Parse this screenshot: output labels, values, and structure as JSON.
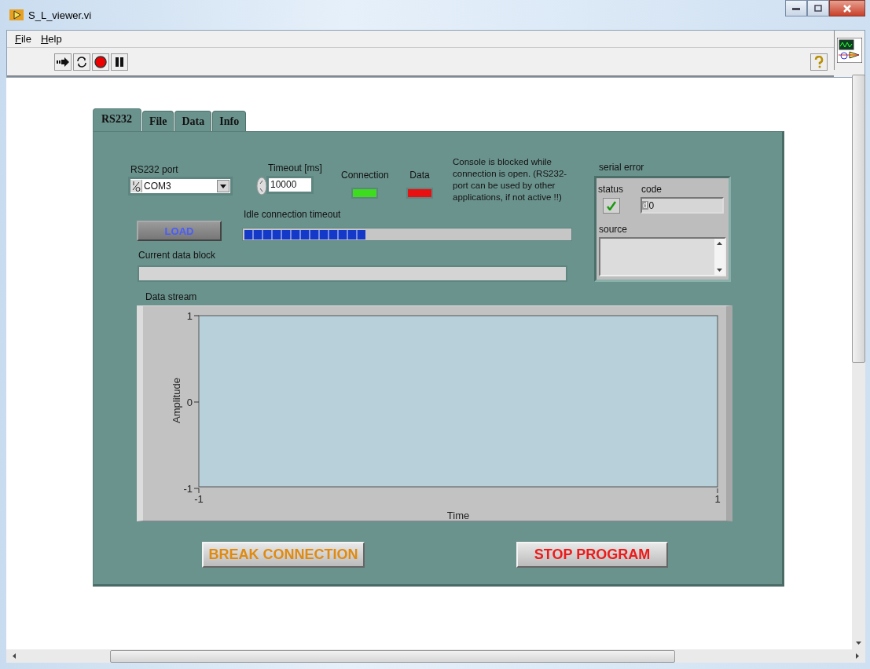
{
  "window": {
    "title": "S_L_viewer.vi"
  },
  "menu": [
    {
      "label": "File"
    },
    {
      "label": "Help"
    }
  ],
  "tabs": [
    {
      "label": "RS232",
      "selected": true
    },
    {
      "label": "File",
      "selected": false
    },
    {
      "label": "Data",
      "selected": false
    },
    {
      "label": "Info",
      "selected": false
    }
  ],
  "rs232_port": {
    "label": "RS232 port",
    "value": "COM3"
  },
  "timeout": {
    "label": "Timeout [ms]",
    "value": "10000"
  },
  "indicators": [
    {
      "label": "Connection",
      "on": true,
      "color": "#3ddc1e"
    },
    {
      "label": "Data",
      "on": true,
      "color": "#e81010"
    }
  ],
  "note": "Console is blocked while connection is open. (RS232-port can be used by other applications, if not active !!)",
  "idle_timeout": {
    "label": "Idle connection timeout",
    "level": 0.37
  },
  "load_button": {
    "label": "LOAD"
  },
  "current_data_block": {
    "label": "Current data block"
  },
  "serial_error": {
    "label": "serial error",
    "status_label": "status",
    "status": {
      "checked": true
    },
    "code_label": "code",
    "code_radix": "d",
    "code": "0",
    "source_label": "source"
  },
  "data_stream": {
    "label": "Data stream",
    "chart_data": {
      "type": "line",
      "xlabel": "Time",
      "ylabel": "Amplitude",
      "xlim": [
        -1,
        1
      ],
      "ylim": [
        -1,
        1
      ],
      "xticks": [
        -1,
        1
      ],
      "yticks": [
        -1,
        0,
        1
      ]
    }
  },
  "buttons": [
    {
      "label": "BREAK CONNECTION",
      "kind": "break"
    },
    {
      "label": "STOP PROGRAM",
      "kind": "stop"
    }
  ]
}
